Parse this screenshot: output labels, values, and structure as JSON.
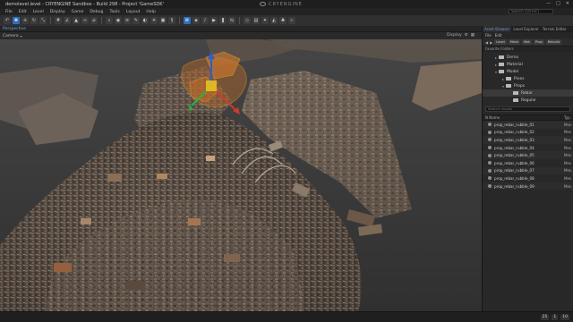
{
  "titlebar": {
    "title": "demolevel.level - CRYENGINE Sandbox - Build 298 - Project 'GameSDK'",
    "brand": "CRYENGINE",
    "minimize": "—",
    "maximize": "□",
    "close": "✕"
  },
  "menubar": {
    "items": [
      "File",
      "Edit",
      "Level",
      "Display",
      "Game",
      "Debug",
      "Tools",
      "Layout",
      "Help"
    ],
    "search_placeholder": "Search (Ctrl+F)"
  },
  "viewport": {
    "tab_label": "Perspective",
    "camera_label": "Camera",
    "display_label": "Display"
  },
  "right_panel": {
    "tabs": [
      "Asset Browser",
      "Level Explorer",
      "Terrain Editor"
    ],
    "menu": [
      "File",
      "Edit"
    ],
    "tool_buttons": [
      "Level",
      "Mesh",
      "Mat",
      "Prop",
      "Rebuild"
    ],
    "section_label": "Favorite Folders",
    "tree": [
      {
        "label": "Demo",
        "depth": 1,
        "expanded": false
      },
      {
        "label": "Material",
        "depth": 1,
        "expanded": false
      },
      {
        "label": "Model",
        "depth": 1,
        "expanded": true
      },
      {
        "label": "Pines",
        "depth": 2,
        "expanded": false
      },
      {
        "label": "Props",
        "depth": 2,
        "expanded": true
      },
      {
        "label": "Rebar",
        "depth": 3,
        "expanded": false,
        "selected": true
      },
      {
        "label": "Regular",
        "depth": 3,
        "expanded": false
      }
    ],
    "search_placeholder": "Search results",
    "columns": {
      "name": "N Name",
      "type": "Typ"
    },
    "assets": [
      {
        "name": "prop_rebar_rubble_01",
        "type": "Mes"
      },
      {
        "name": "prop_rebar_rubble_02",
        "type": "Mes"
      },
      {
        "name": "prop_rebar_rubble_03",
        "type": "Mes"
      },
      {
        "name": "prop_rebar_rubble_04",
        "type": "Mes"
      },
      {
        "name": "prop_rebar_rubble_05",
        "type": "Mes"
      },
      {
        "name": "prop_rebar_rubble_06",
        "type": "Mes"
      },
      {
        "name": "prop_rebar_rubble_07",
        "type": "Mes"
      },
      {
        "name": "prop_rebar_rubble_08",
        "type": "Mes"
      },
      {
        "name": "prop_rebar_rubble_09",
        "type": "Mes"
      }
    ]
  },
  "statusbar": {
    "values": [
      "25",
      "1",
      "10"
    ]
  },
  "colors": {
    "accent": "#2f6fbf",
    "gizmo_orange": "#e8961a",
    "gizmo_red": "#d23a2a",
    "gizmo_green": "#2fae3e",
    "gizmo_blue": "#2a5fd6"
  }
}
